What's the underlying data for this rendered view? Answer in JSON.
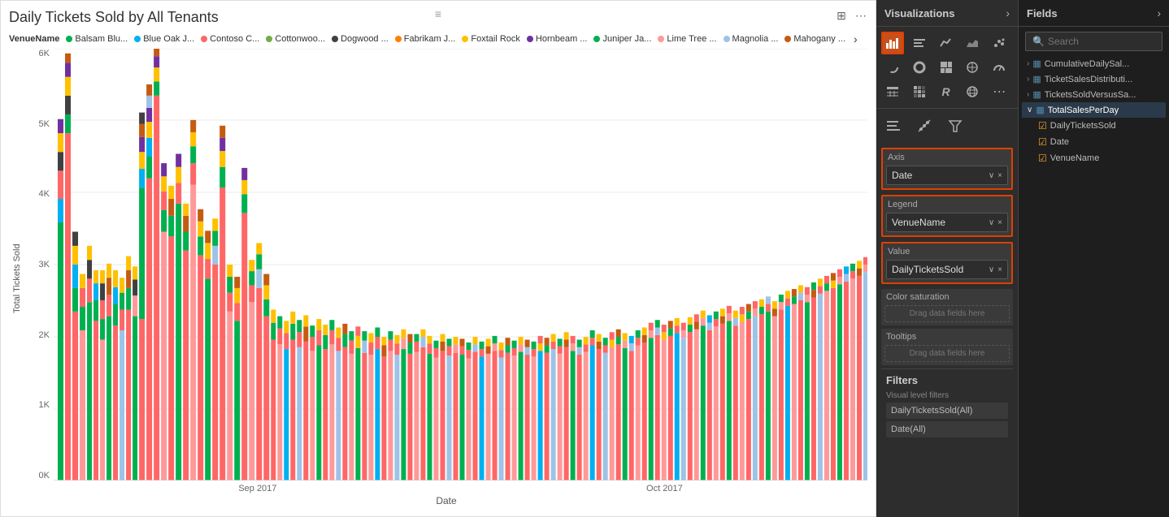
{
  "chart": {
    "title": "Daily Tickets Sold by All Tenants",
    "x_axis_label": "Date",
    "y_axis_label": "Total Tickets Sold",
    "y_ticks": [
      "6K",
      "5K",
      "4K",
      "3K",
      "2K",
      "1K",
      "0K"
    ],
    "x_labels": [
      "Sep 2017",
      "Oct 2017"
    ],
    "legend_label": "VenueName",
    "legend_items": [
      {
        "label": "Balsam Blu...",
        "color": "#00b050"
      },
      {
        "label": "Blue Oak J...",
        "color": "#00b0f0"
      },
      {
        "label": "Contoso C...",
        "color": "#ff6666"
      },
      {
        "label": "Cottonwoo...",
        "color": "#70ad47"
      },
      {
        "label": "Dogwood ...",
        "color": "#404040"
      },
      {
        "label": "Fabrikam J...",
        "color": "#ff7f00"
      },
      {
        "label": "Foxtail Rock",
        "color": "#ffc000"
      },
      {
        "label": "Hornbeam ...",
        "color": "#7030a0"
      },
      {
        "label": "Juniper Ja...",
        "color": "#00b050"
      },
      {
        "label": "Lime Tree ...",
        "color": "#ff9999"
      },
      {
        "label": "Magnolia ...",
        "color": "#9dc3e6"
      },
      {
        "label": "Mahogany ...",
        "color": "#c55a11"
      },
      {
        "label": "more",
        "color": null
      }
    ]
  },
  "visualizations": {
    "header": "Visualizations",
    "fields_header": "Fields",
    "search_placeholder": "Search",
    "axis_label": "Axis",
    "axis_value": "Date",
    "legend_label": "Legend",
    "legend_value": "VenueName",
    "value_label": "Value",
    "value_value": "DailyTicketsSold",
    "color_saturation_label": "Color saturation",
    "drag_placeholder1": "Drag data fields here",
    "tooltips_label": "Tooltips",
    "drag_placeholder2": "Drag data fields here",
    "filters_title": "Filters",
    "visual_level_label": "Visual level filters",
    "filter1": "DailyTicketsSold(All)",
    "filter2": "Date(All)"
  },
  "fields": {
    "items": [
      {
        "label": "CumulativeDailySal...",
        "type": "table",
        "expanded": false,
        "id": "cumulative"
      },
      {
        "label": "TicketSalesDistributi...",
        "type": "table",
        "expanded": false,
        "id": "ticket-dist"
      },
      {
        "label": "TicketsSoldVersusSa...",
        "type": "table",
        "expanded": false,
        "id": "tickets-vs"
      },
      {
        "label": "TotalSalesPerDay",
        "type": "table",
        "expanded": true,
        "active": true,
        "id": "total-sales",
        "children": [
          {
            "label": "DailyTicketsSold",
            "checked": true,
            "id": "daily-tickets"
          },
          {
            "label": "Date",
            "checked": true,
            "id": "date-field"
          },
          {
            "label": "VenueName",
            "checked": true,
            "id": "venue-name"
          }
        ]
      }
    ]
  },
  "icons": {
    "drag_handle": "≡",
    "expand": "⊞",
    "more": "⋯",
    "search": "🔍",
    "arrow_right": "›",
    "arrow_down": "∨",
    "close": "×",
    "check": "✓"
  }
}
